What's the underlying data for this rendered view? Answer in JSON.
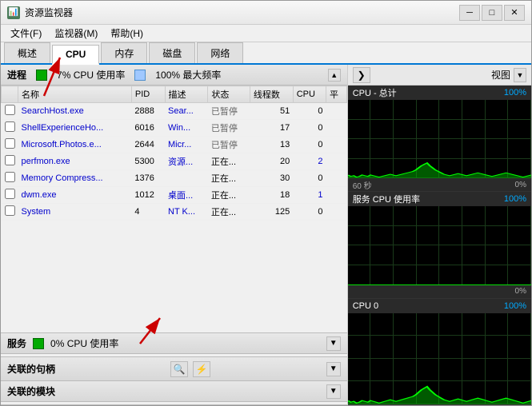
{
  "window": {
    "title": "资源监视器",
    "icon": "📊"
  },
  "menu": {
    "items": [
      "文件(F)",
      "监视器(M)",
      "帮助(H)"
    ]
  },
  "tabs": [
    {
      "label": "概述",
      "active": false
    },
    {
      "label": "CPU",
      "active": true
    },
    {
      "label": "内存",
      "active": false
    },
    {
      "label": "磁盘",
      "active": false
    },
    {
      "label": "网络",
      "active": false
    }
  ],
  "process_section": {
    "title": "进程",
    "cpu_indicator_color": "#00aa00",
    "cpu_usage": "7% CPU 使用率",
    "max_freq": "100% 最大频率",
    "columns": [
      "名称",
      "PID",
      "描述",
      "状态",
      "线程数",
      "CPU",
      "平"
    ],
    "rows": [
      {
        "name": "SearchHost.exe",
        "pid": "2888",
        "desc": "Sear...",
        "status": "已暂停",
        "threads": "51",
        "cpu": "0",
        "avg": ""
      },
      {
        "name": "ShellExperienceHo...",
        "pid": "6016",
        "desc": "Win...",
        "status": "已暂停",
        "threads": "17",
        "cpu": "0",
        "avg": ""
      },
      {
        "name": "Microsoft.Photos.e...",
        "pid": "2644",
        "desc": "Micr...",
        "status": "已暂停",
        "threads": "13",
        "cpu": "0",
        "avg": ""
      },
      {
        "name": "perfmon.exe",
        "pid": "5300",
        "desc": "资源...",
        "status": "正在...",
        "threads": "20",
        "cpu": "2",
        "avg": ""
      },
      {
        "name": "Memory Compress...",
        "pid": "1376",
        "desc": "",
        "status": "正在...",
        "threads": "30",
        "cpu": "0",
        "avg": ""
      },
      {
        "name": "dwm.exe",
        "pid": "1012",
        "desc": "桌面...",
        "status": "正在...",
        "threads": "18",
        "cpu": "1",
        "avg": ""
      },
      {
        "name": "System",
        "pid": "4",
        "desc": "NT K...",
        "status": "正在...",
        "threads": "125",
        "cpu": "0",
        "avg": ""
      }
    ]
  },
  "services_section": {
    "title": "服务",
    "cpu_indicator_color": "#00aa00",
    "cpu_usage": "0% CPU 使用率"
  },
  "handles_section": {
    "title": "关联的句柄"
  },
  "modules_section": {
    "title": "关联的模块"
  },
  "right_panel": {
    "view_label": "视图",
    "graphs": [
      {
        "title": "CPU - 总计",
        "pct": "100%",
        "time_label": "60 秒",
        "val_label": "0%",
        "data": [
          5,
          3,
          4,
          2,
          3,
          5,
          4,
          3,
          5,
          4,
          3,
          2,
          3,
          4,
          5,
          6,
          5,
          4,
          5,
          6,
          7,
          8,
          9,
          10,
          12,
          15,
          18,
          20,
          22,
          18,
          15,
          12,
          10,
          8,
          6,
          5,
          4,
          5,
          6,
          7,
          6,
          5,
          4,
          5,
          6,
          7,
          8,
          7,
          6,
          5,
          4,
          3,
          4,
          5,
          6,
          7,
          8,
          7,
          6,
          5,
          4,
          3,
          2,
          3,
          4,
          5
        ]
      },
      {
        "title": "服务 CPU 使用率",
        "pct": "100%",
        "time_label": "",
        "val_label": "0%",
        "data": [
          0,
          0,
          0,
          0,
          0,
          0,
          0,
          0,
          0,
          0,
          0,
          0,
          0,
          0,
          0,
          0,
          0,
          0,
          0,
          0,
          0,
          0,
          0,
          0,
          0,
          0,
          0,
          0,
          0,
          0,
          0,
          0,
          0,
          0,
          0,
          0,
          0,
          0,
          0,
          0,
          0,
          0,
          0,
          0,
          0,
          0,
          0,
          0,
          0,
          0,
          0,
          0,
          0,
          0,
          0,
          0,
          0,
          0,
          0,
          0,
          0,
          0,
          0,
          0,
          0,
          0
        ]
      },
      {
        "title": "CPU 0",
        "pct": "100%",
        "time_label": "",
        "val_label": "",
        "data": [
          5,
          3,
          4,
          2,
          3,
          5,
          4,
          3,
          5,
          4,
          3,
          2,
          3,
          4,
          5,
          6,
          5,
          4,
          5,
          6,
          7,
          8,
          9,
          10,
          12,
          15,
          18,
          20,
          22,
          18,
          15,
          12,
          10,
          8,
          6,
          5,
          4,
          5,
          6,
          7,
          6,
          5,
          4,
          5,
          6,
          7,
          8,
          7,
          6,
          5,
          4,
          3,
          4,
          5,
          6,
          7,
          8,
          7,
          6,
          5,
          4,
          3,
          2,
          3,
          4,
          5
        ]
      }
    ]
  }
}
